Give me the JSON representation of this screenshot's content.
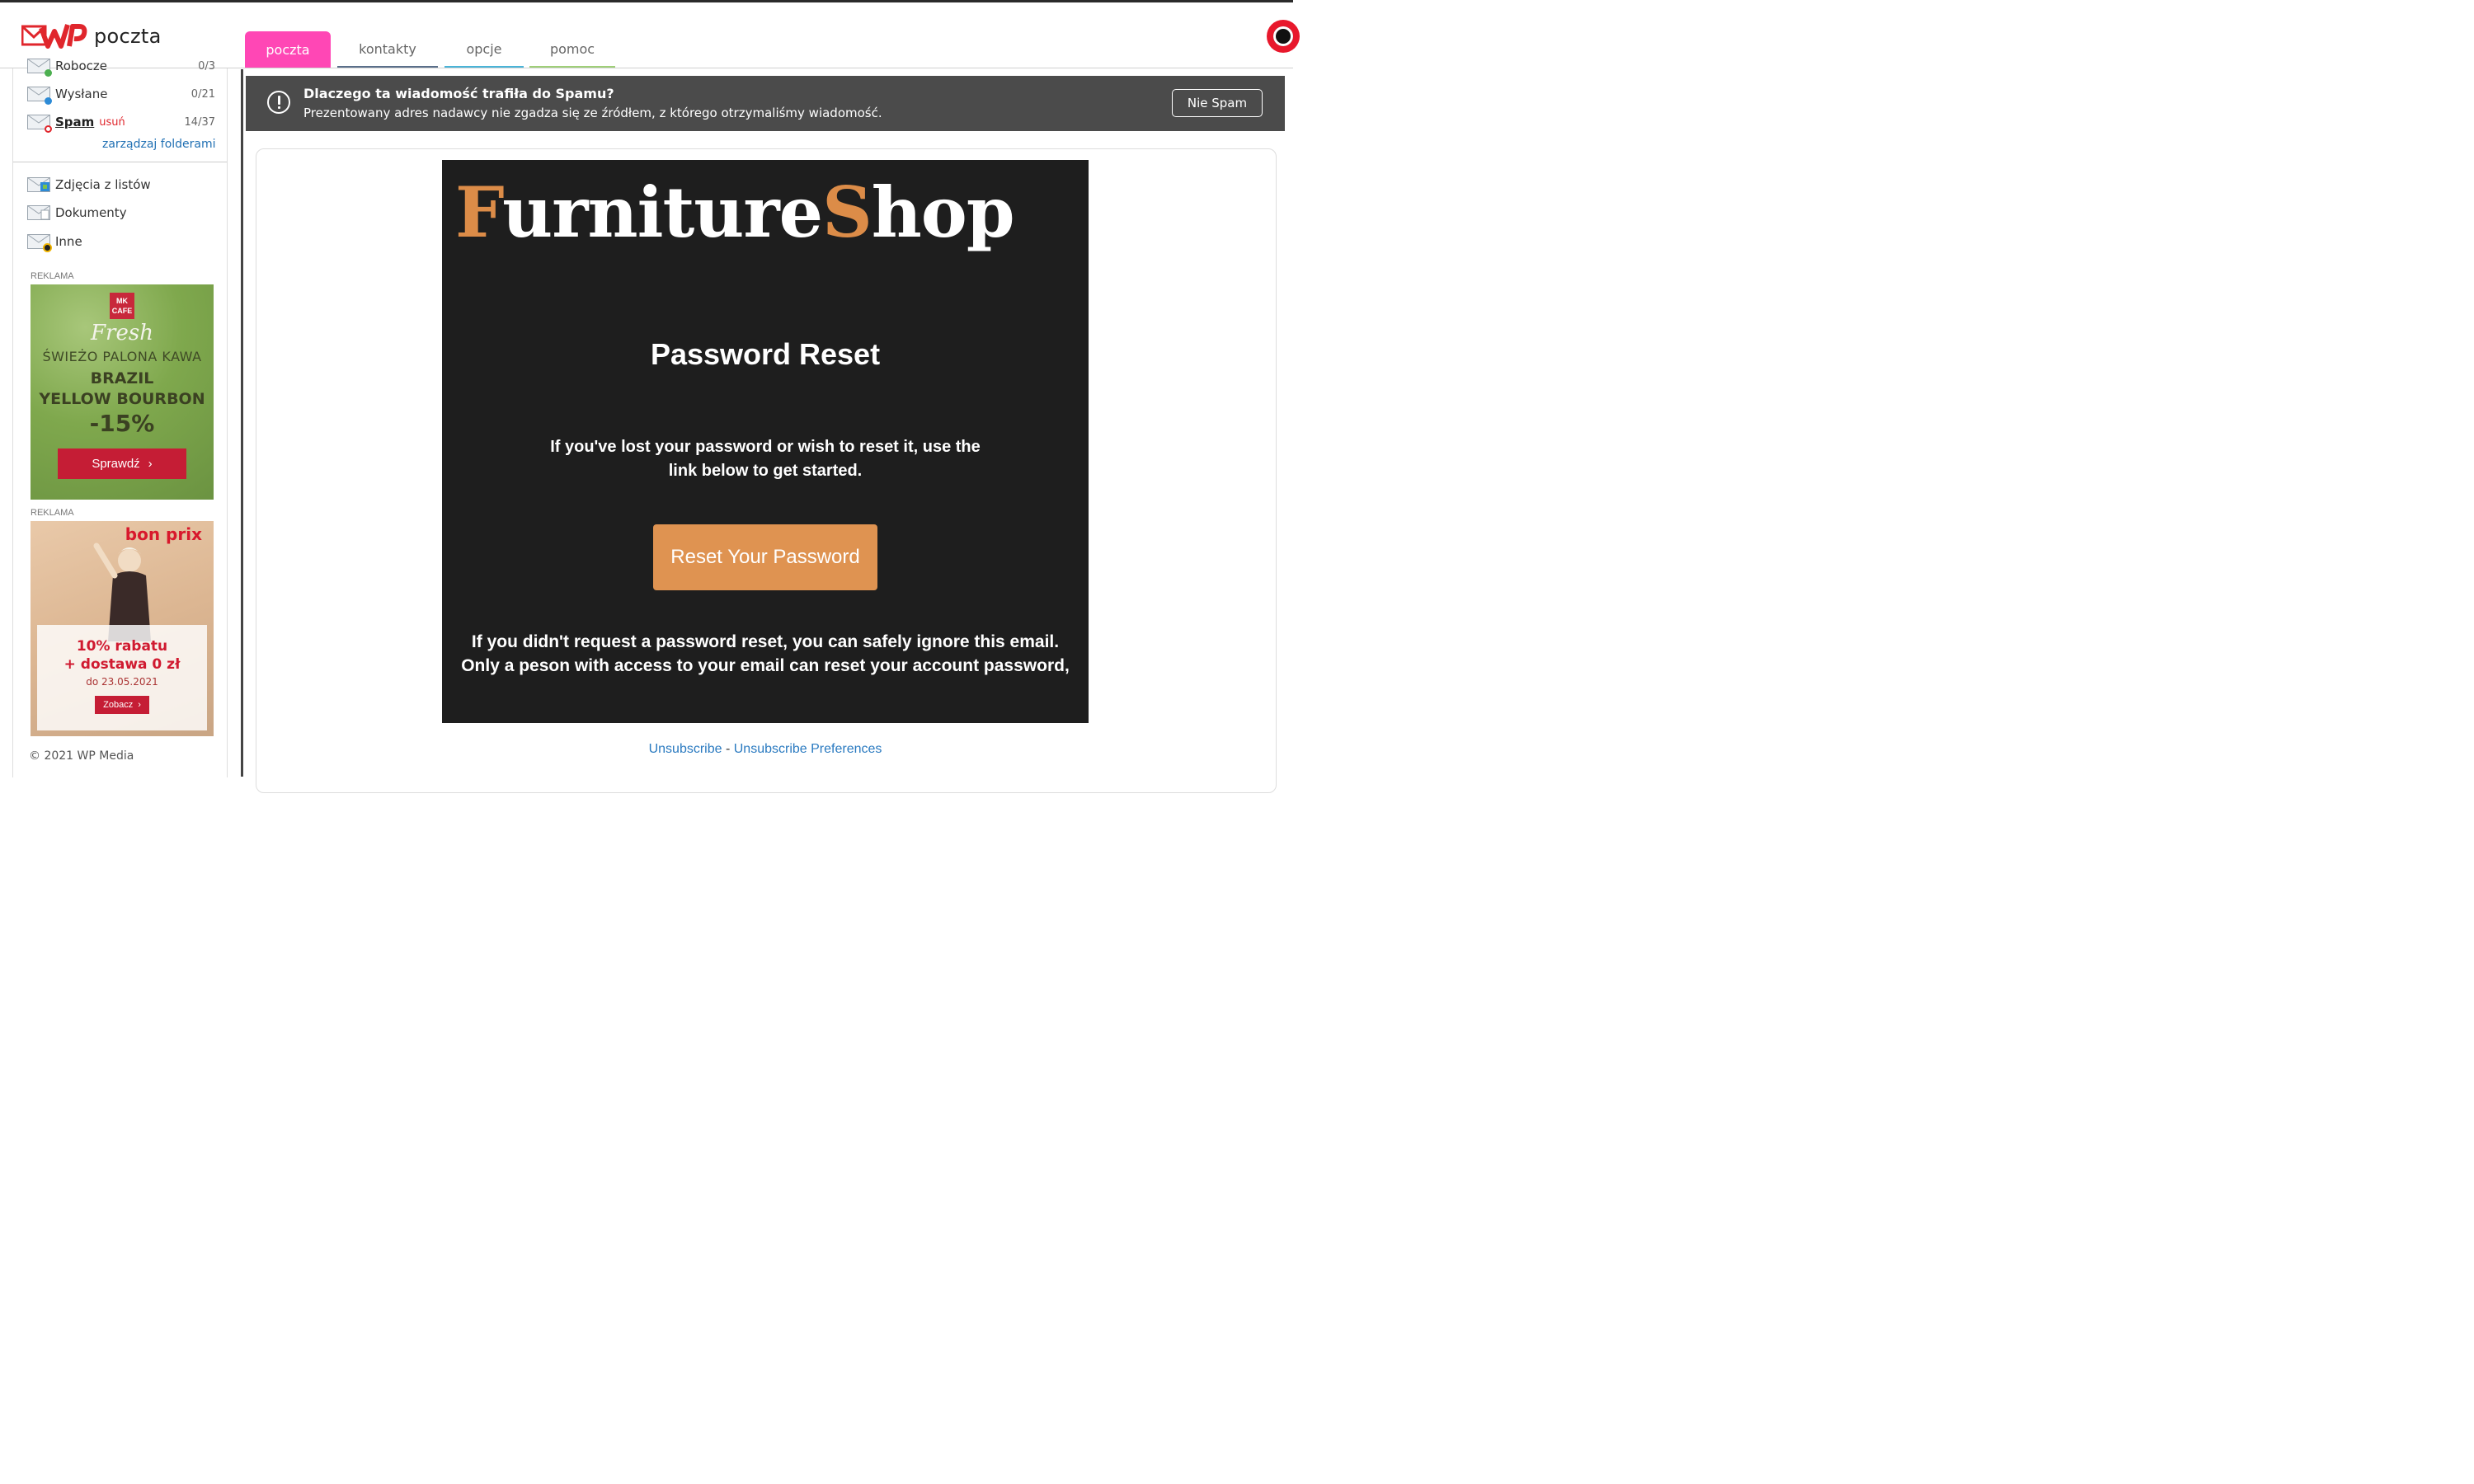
{
  "app": {
    "logo_text": "poczta",
    "brand_color": "#e0262c"
  },
  "tabs": [
    {
      "label": "poczta",
      "active": true,
      "color": "#ff47b5"
    },
    {
      "label": "kontakty",
      "active": false,
      "color": "#5a6f8a"
    },
    {
      "label": "opcje",
      "active": false,
      "color": "#4ab4d8"
    },
    {
      "label": "pomoc",
      "active": false,
      "color": "#9fcf78"
    }
  ],
  "sidebar": {
    "folders": [
      {
        "label": "Robocze",
        "count": "0/3",
        "icon": "draft-envelope-icon"
      },
      {
        "label": "Wysłane",
        "count": "0/21",
        "icon": "sent-envelope-icon"
      },
      {
        "label": "Spam",
        "action": "usuń",
        "count": "14/37",
        "icon": "spam-envelope-icon"
      }
    ],
    "manage_label": "zarządzaj folderami",
    "smart_folders": [
      {
        "label": "Zdjęcia z listów",
        "icon": "photo-envelope-icon"
      },
      {
        "label": "Dokumenty",
        "icon": "document-envelope-icon"
      },
      {
        "label": "Inne",
        "icon": "other-envelope-icon"
      }
    ],
    "ads": [
      {
        "label": "REKLAMA",
        "badge": "MK CAFE",
        "script": "Fresh",
        "line1": "ŚWIEŻO PALONA KAWA",
        "line2": "BRAZIL",
        "line3": "YELLOW BOURBON",
        "line4": "-15%",
        "button": "Sprawdź"
      },
      {
        "label": "REKLAMA",
        "brand": "bon prix",
        "line1": "10% rabatu",
        "line2": "+ dostawa 0 zł",
        "line3": "do 23.05.2021",
        "button": "Zobacz"
      }
    ],
    "copyright": "© 2021 WP Media"
  },
  "spam_notice": {
    "title": "Dlaczego ta wiadomość trafiła do Spamu?",
    "description": "Prezentowany adres nadawcy nie zgadza się ze źródłem, z którego otrzymaliśmy wiadomość.",
    "button": "Nie Spam"
  },
  "email": {
    "brand_part1_hl": "F",
    "brand_part1": "urniture",
    "brand_part2_hl": "S",
    "brand_part2": "hop",
    "accent_color": "#dc8c48",
    "heading": "Password Reset",
    "intro": "If you've lost your password or wish to reset it, use the link below to get started.",
    "button": "Reset Your Password",
    "note": "If you didn't request a password reset, you can safely ignore this email. Only a peson with access to your email can reset your account password,",
    "footer_link1": "Unsubscribe",
    "footer_sep": " - ",
    "footer_link2": "Unsubscribe Preferences"
  }
}
